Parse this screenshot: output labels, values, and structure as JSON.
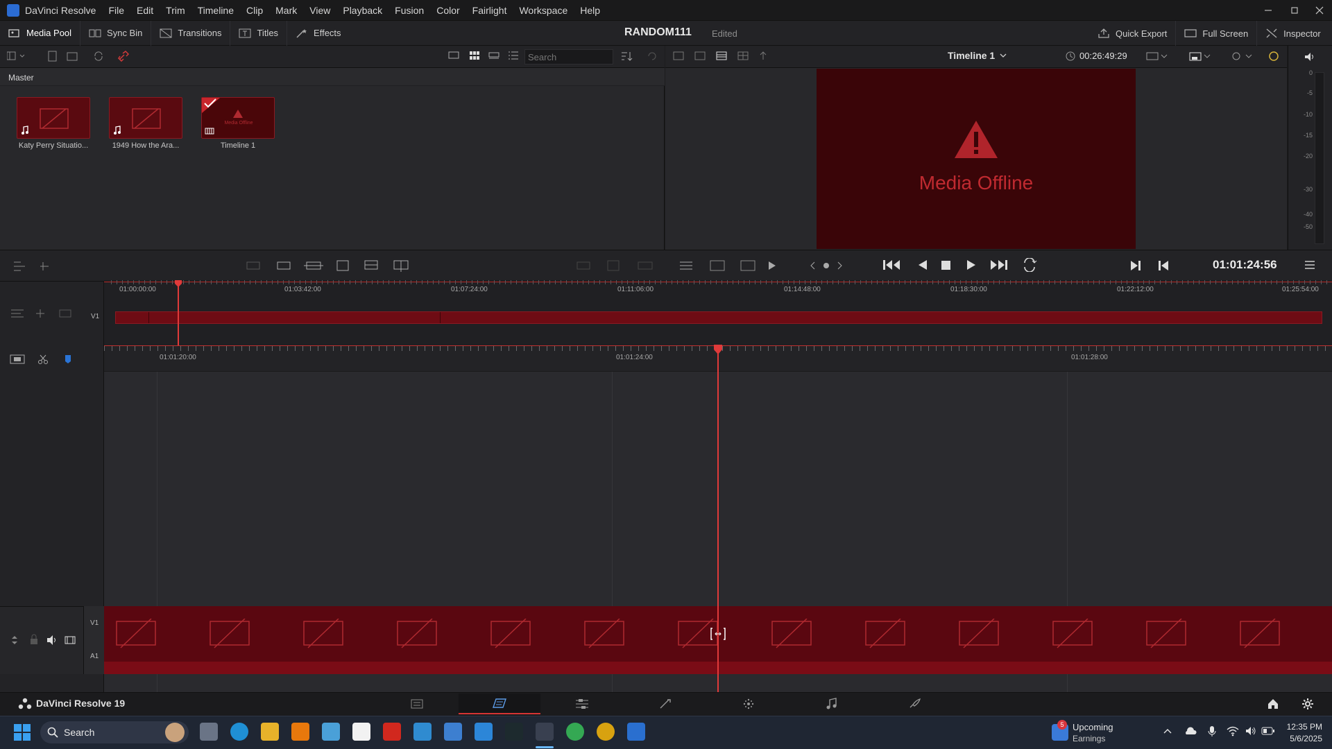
{
  "window": {
    "app_title": "DaVinci Resolve"
  },
  "menu": [
    "File",
    "Edit",
    "Trim",
    "Timeline",
    "Clip",
    "Mark",
    "View",
    "Playback",
    "Fusion",
    "Color",
    "Fairlight",
    "Workspace",
    "Help"
  ],
  "toolbar": {
    "media_pool": "Media Pool",
    "sync_bin": "Sync Bin",
    "transitions": "Transitions",
    "titles": "Titles",
    "effects": "Effects",
    "quick_export": "Quick Export",
    "full_screen": "Full Screen",
    "inspector": "Inspector"
  },
  "project": {
    "name": "RANDOM111",
    "status": "Edited"
  },
  "media_pool": {
    "search_placeholder": "Search",
    "bin": "Master",
    "clips": [
      {
        "name": "Katy Perry Situatio...",
        "type": "audio"
      },
      {
        "name": "1949 How the Ara...",
        "type": "audio"
      },
      {
        "name": "Timeline 1",
        "type": "timeline",
        "thumb_text": "Media Offline"
      }
    ]
  },
  "viewer": {
    "timeline_name": "Timeline 1",
    "source_duration": "00:26:49:29",
    "offline_text": "Media Offline",
    "current_timecode": "01:01:24:56",
    "meter_labels": [
      "0",
      "-5",
      "-10",
      "-15",
      "-20",
      "-30",
      "-40",
      "-50"
    ]
  },
  "mini_timeline": {
    "ruler": [
      "01:00:00:00",
      "01:03:42:00",
      "01:07:24:00",
      "01:11:06:00",
      "01:14:48:00",
      "01:18:30:00",
      "01:22:12:00",
      "01:25:54:00"
    ],
    "track": "V1"
  },
  "timeline": {
    "ruler": [
      "01:01:20:00",
      "01:01:24:00",
      "01:01:28:00"
    ],
    "video_track": "V1",
    "audio_track": "A1"
  },
  "pages": {
    "brand": "DaVinci Resolve 19"
  },
  "taskbar": {
    "search": "Search",
    "weather_badge": "5",
    "weather_title": "Upcoming",
    "weather_sub": "Earnings",
    "time": "12:35 PM",
    "date": "5/6/2025"
  }
}
